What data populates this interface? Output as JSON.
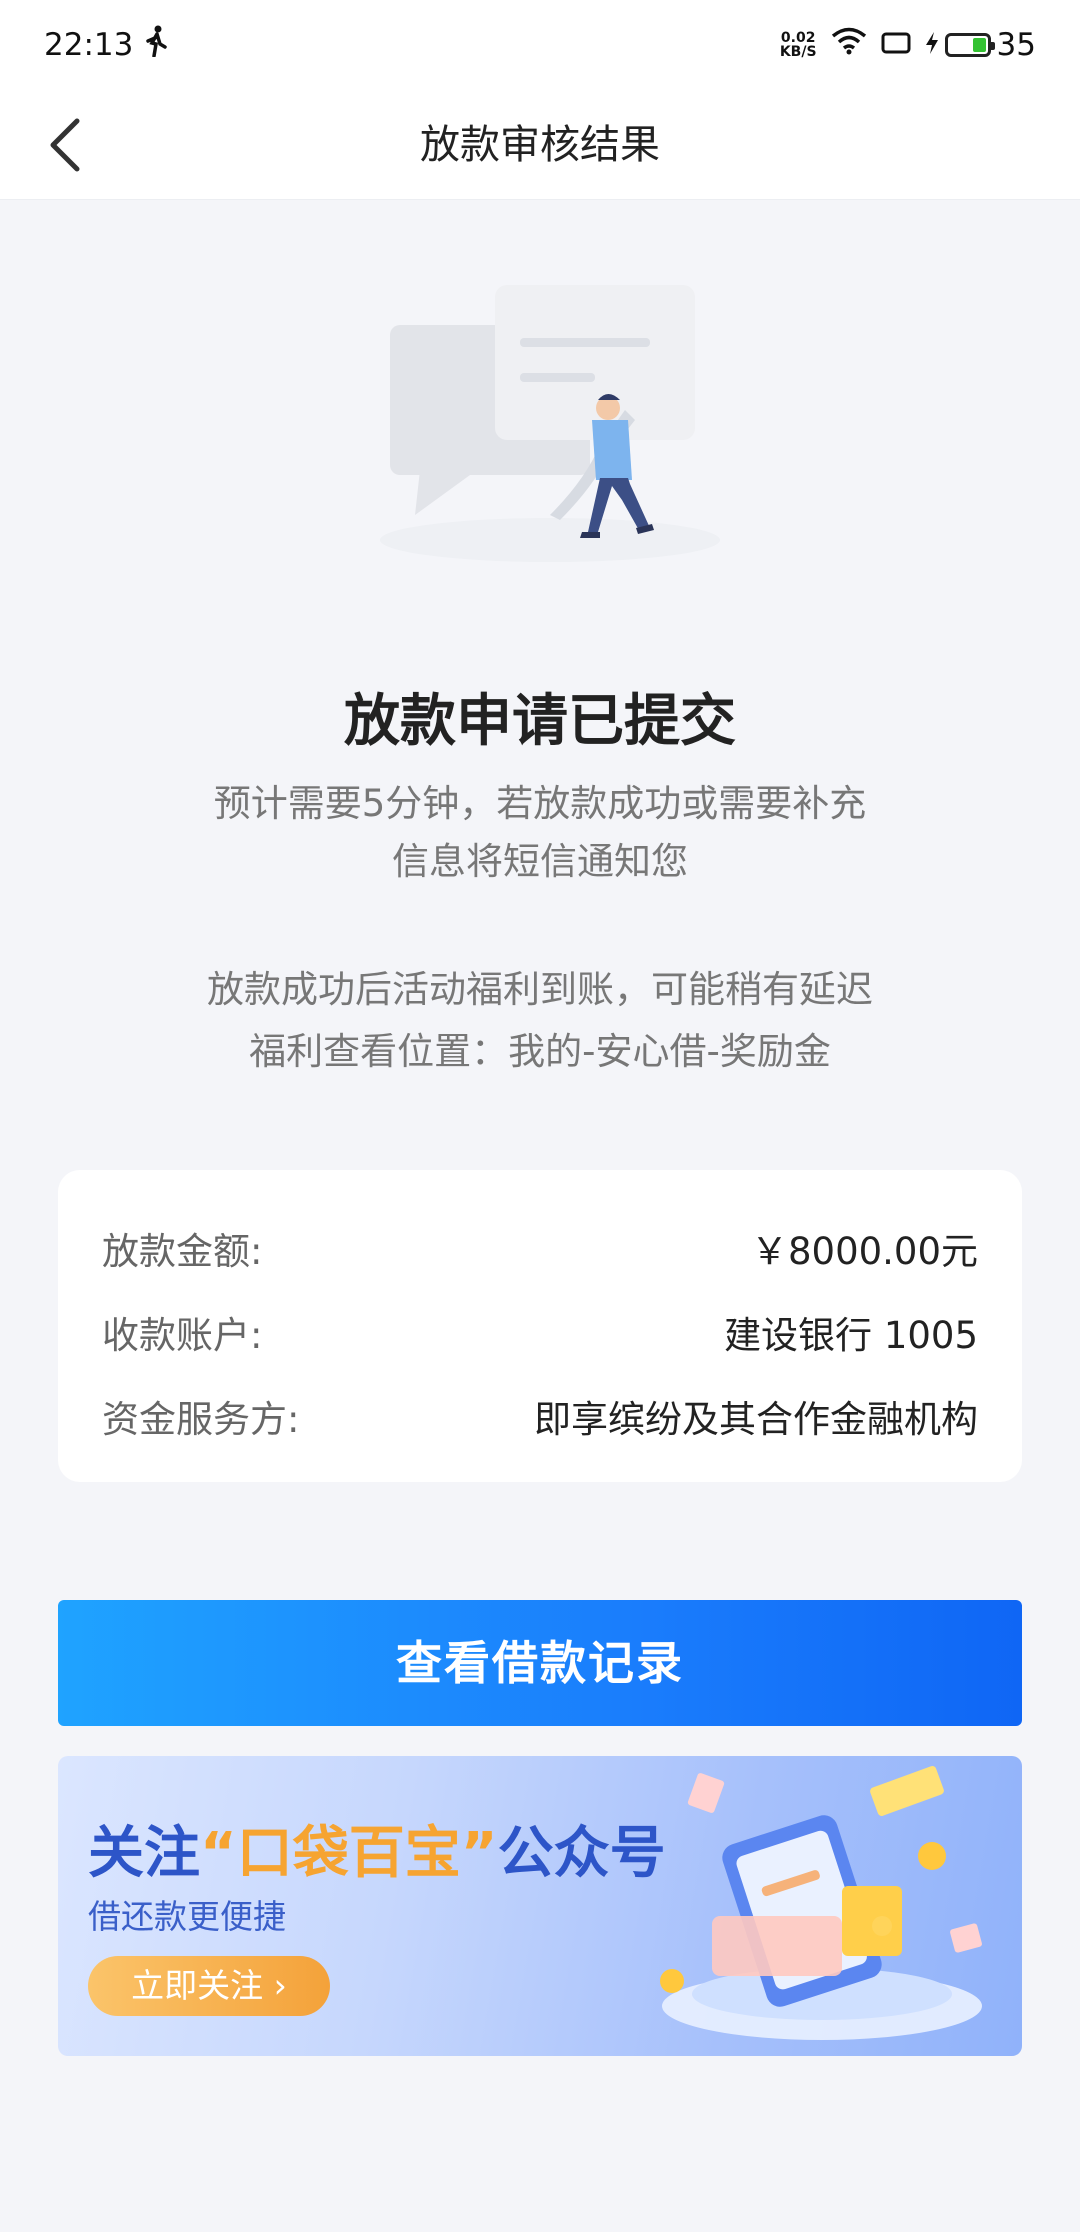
{
  "status": {
    "time": "22:13",
    "net_speed_value": "0.02",
    "net_speed_unit": "KB/S",
    "battery": "35",
    "battery_level": 0.35
  },
  "nav": {
    "title": "放款审核结果"
  },
  "result": {
    "headline": "放款申请已提交",
    "desc_line1": "预计需要5分钟，若放款成功或需要补充",
    "desc_line2": "信息将短信通知您",
    "note_line1": "放款成功后活动福利到账，可能稍有延迟",
    "note_line2": "福利查看位置：我的-安心借-奖励金"
  },
  "info": {
    "rows": [
      {
        "label": "放款金额:",
        "value": "￥8000.00元"
      },
      {
        "label": "收款账户:",
        "value": "建设银行 1005"
      },
      {
        "label": "资金服务方:",
        "value": "即享缤纷及其合作金融机构"
      }
    ]
  },
  "actions": {
    "view_records": "查看借款记录"
  },
  "banner": {
    "title_prefix": "关注",
    "title_highlight": "“口袋百宝”",
    "title_suffix": "公众号",
    "subtitle": "借还款更便捷",
    "button": "立即关注 ›"
  },
  "colors": {
    "primary": "#1a7dfc",
    "banner_blue": "#2d55c8",
    "banner_orange": "#f6a431"
  }
}
